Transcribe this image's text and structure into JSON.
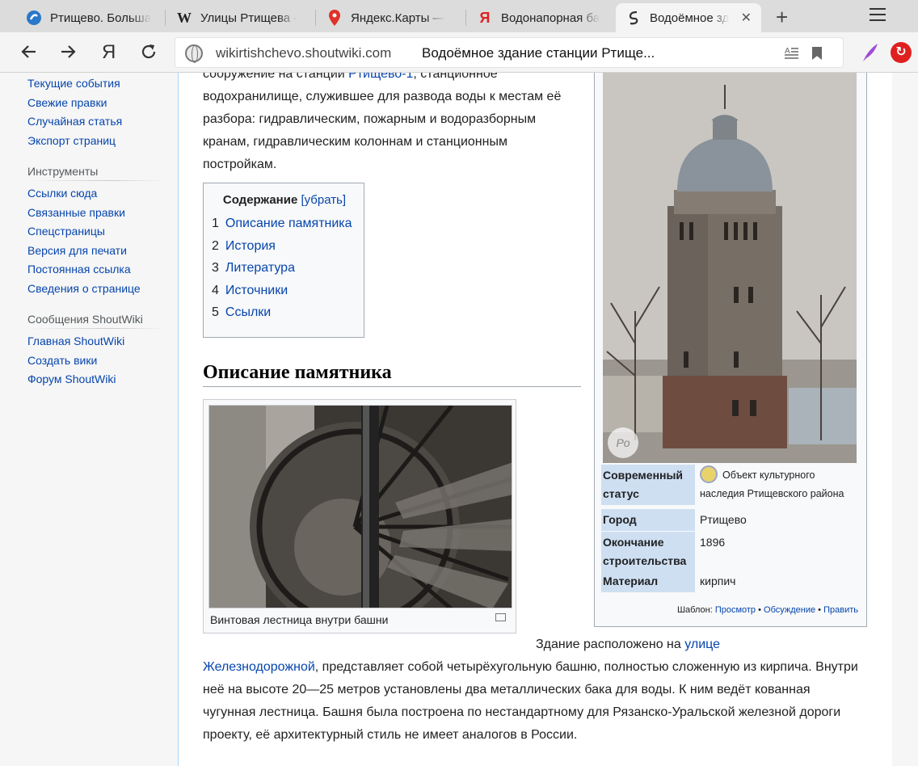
{
  "browser": {
    "tabs": [
      {
        "title": "Ртищево. Больша",
        "favicon": "s-blue-icon"
      },
      {
        "title": "Улицы Ртищева -",
        "favicon": "wikipedia-icon"
      },
      {
        "title": "Яндекс.Карты —",
        "favicon": "map-pin-icon"
      },
      {
        "title": "Водонапорная ба",
        "favicon": "yandex-icon"
      },
      {
        "title": "Водоёмное зд",
        "favicon": "shoutwiki-icon"
      }
    ],
    "close_glyph": "✕",
    "new_tab_glyph": "+",
    "address": {
      "url": "wikirtishchevo.shoutwiki.com",
      "page_title": "Водоёмное здание станции Ртище..."
    },
    "yandex_glyph": "Я",
    "colors": {
      "accent_red": "#e02020",
      "link": "#0645ad"
    }
  },
  "sidebar": {
    "nav_items": [
      "Текущие события",
      "Свежие правки",
      "Случайная статья",
      "Экспорт страниц"
    ],
    "tools_heading": "Инструменты",
    "tools_items": [
      "Ссылки сюда",
      "Связанные правки",
      "Спецстраницы",
      "Версия для печати",
      "Постоянная ссылка",
      "Сведения о странице"
    ],
    "shoutwiki_heading": "Сообщения ShoutWiki",
    "shoutwiki_items": [
      "Главная ShoutWiki",
      "Создать вики",
      "Форум ShoutWiki"
    ]
  },
  "article": {
    "intro": {
      "before_link": "сооружение на станции ",
      "link": "Ртищево-1",
      "after_link": ", станционное водохранилище, служившее для развода воды к местам её разбора: гидравлическим, пожарным и водоразборным кранам, гидравлическим колоннам и станционным постройкам."
    },
    "toc": {
      "title": "Содержание",
      "toggle": "[убрать]",
      "items": [
        {
          "num": "1",
          "label": "Описание памятника"
        },
        {
          "num": "2",
          "label": "История"
        },
        {
          "num": "3",
          "label": "Литература"
        },
        {
          "num": "4",
          "label": "Источники"
        },
        {
          "num": "5",
          "label": "Ссылки"
        }
      ]
    },
    "section_heading": "Описание памятника",
    "thumb_caption": "Винтовая лестница внутри башни",
    "body": {
      "lead": "Здание расположено на ",
      "link1": "улице",
      "link2": "Железнодорожной",
      "rest": ", представляет собой четырёхугольную башню, полностью сложенную из кирпича. Внутри неё на высоте 20—25 метров установлены два металлических бака для воды. К ним ведёт кованная чугунная лестница. Башня была построена по нестандартному для Рязанско-Уральской железной дороги проекту, её архитектурный стиль не имеет аналогов в России."
    },
    "infobox": {
      "rows": [
        {
          "label": "Современный статус",
          "value": "Объект культурного наследия Ртищевского района"
        },
        {
          "label": "Город",
          "value": "Ртищево"
        },
        {
          "label": "Окончание строительства",
          "value": "1896"
        },
        {
          "label": "Материал",
          "value": "кирпич"
        }
      ],
      "footer": {
        "prefix": "Шаблон: ",
        "view": "Просмотр",
        "discuss": "Обсуждение",
        "edit": "Править",
        "sep": " • "
      }
    }
  }
}
